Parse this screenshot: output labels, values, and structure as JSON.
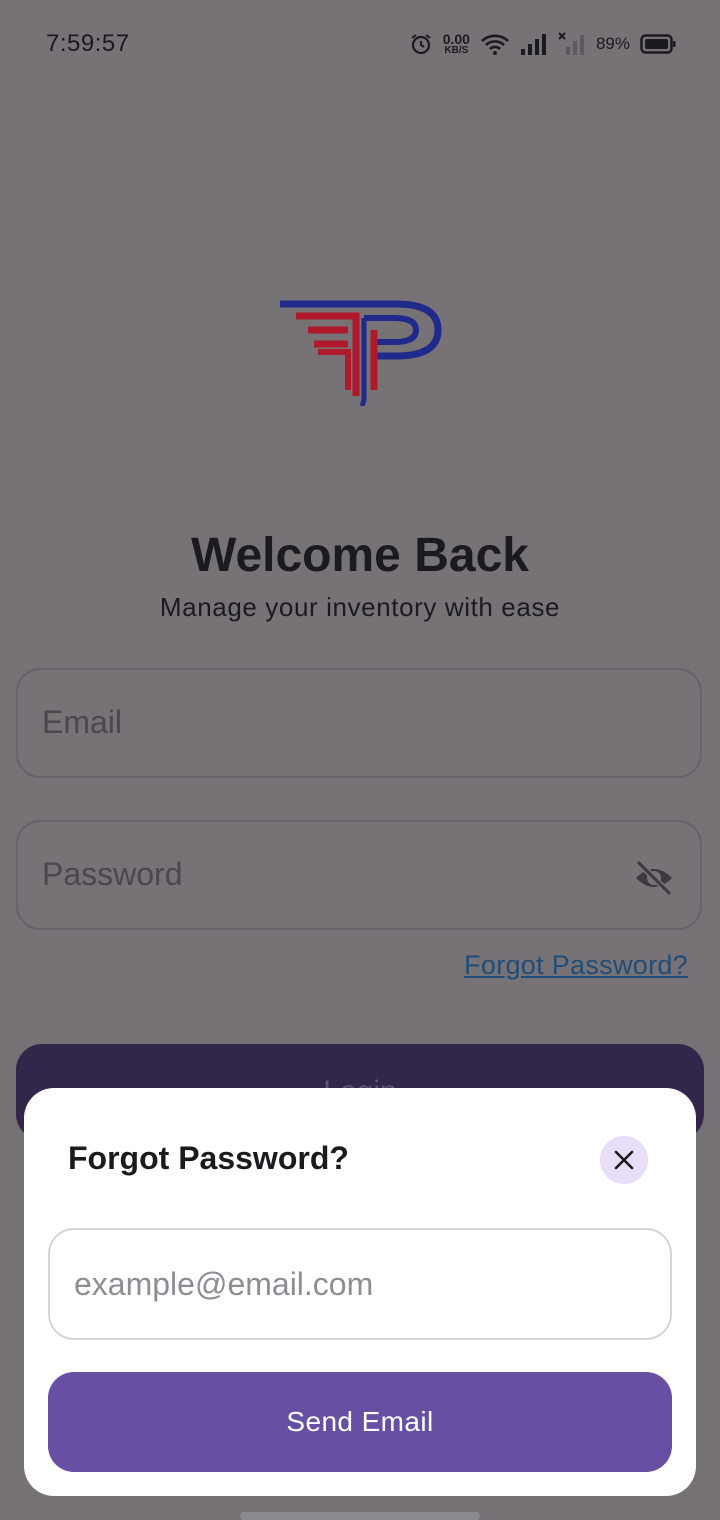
{
  "status_bar": {
    "time": "7:59:57",
    "net_speed_value": "0.00",
    "net_speed_unit": "KB/S",
    "battery_percent": "89%",
    "icons": [
      "alarm-icon",
      "wifi-icon",
      "signal-icon",
      "no-signal-icon",
      "battery-icon"
    ]
  },
  "login": {
    "title": "Welcome Back",
    "subtitle": "Manage your inventory with ease",
    "email_placeholder": "Email",
    "password_placeholder": "Password",
    "forgot_link": "Forgot Password?",
    "login_button": "Login"
  },
  "dialog": {
    "title": "Forgot Password?",
    "email_placeholder": "example@email.com",
    "send_button": "Send Email"
  },
  "colors": {
    "scrim": "#767276",
    "primary": "#6750a4",
    "close_bg": "#e8def8",
    "link": "#1f4c78",
    "logo_blue": "#1f2a8a",
    "logo_red": "#b0182b"
  }
}
